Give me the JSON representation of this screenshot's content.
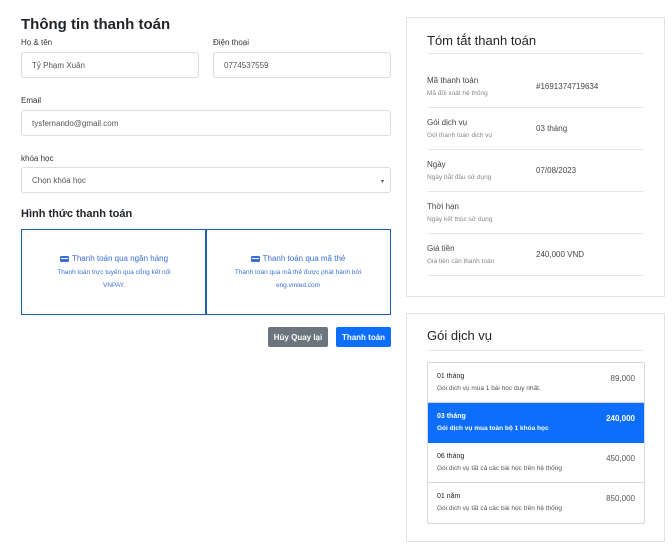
{
  "form": {
    "title": "Thông tin thanh toán",
    "name_label": "Họ & tên",
    "name_value": "Tỷ Phạm Xuân",
    "phone_label": "Điện thoại",
    "phone_value": "0774537559",
    "email_label": "Email",
    "email_value": "tysfernando@gmail.com",
    "course_label": "khóa học",
    "course_value": "Chọn khóa học",
    "payment_title": "Hình thức thanh toán",
    "payment_methods": [
      {
        "title": "Thanh toán qua ngân hàng",
        "desc_line1": "Thanh toán trực tuyến qua cổng kết nối",
        "desc_line2": "VNPAY.",
        "icon": "bank-card-icon"
      },
      {
        "title": "Thanh toán qua mã thẻ",
        "desc_line1": "Thanh toán qua mã thẻ được phát hành bởi",
        "desc_line2": "eng.vmied.com",
        "icon": "credit-card-icon"
      }
    ],
    "cancel_label": "Hủy Quay lại",
    "submit_label": "Thanh toán"
  },
  "summary": {
    "title": "Tóm tắt thanh toán",
    "rows": [
      {
        "key": "Mã thanh toán",
        "sub": "Mã đối xoát hệ thống",
        "value": "#1691374719634"
      },
      {
        "key": "Gói dịch vụ",
        "sub": "Gói thanh toán dịch vụ",
        "value": "03 tháng"
      },
      {
        "key": "Ngày",
        "sub": "Ngày bắt đầu sử dụng",
        "value": "07/08/2023"
      },
      {
        "key": "Thời hạn",
        "sub": "Ngày kết thúc sử dụng",
        "value": ""
      },
      {
        "key": "Giá tiền",
        "sub": "Giá tiền cần thanh toán",
        "value": "240,000 VND"
      }
    ]
  },
  "plans": {
    "title": "Gói dịch vụ",
    "items": [
      {
        "name": "01 tháng",
        "desc": "Gói dịch vụ mua 1 bài học duy nhất.",
        "price": "89,000",
        "active": false
      },
      {
        "name": "03 tháng",
        "desc": "Gói dịch vụ mua toàn bộ 1 khóa học",
        "price": "240,000",
        "active": true
      },
      {
        "name": "06 tháng",
        "desc": "Gói dịch vụ tất cả các bài học trên hệ thống",
        "price": "450,000",
        "active": false
      },
      {
        "name": "01 năm",
        "desc": "Gói dịch vụ tất cả các bài học trên hệ thống",
        "price": "850,000",
        "active": false
      }
    ]
  },
  "colors": {
    "primary": "#0d6efd",
    "secondary": "#6c757d",
    "payment_border": "#1f5fa8",
    "payment_text": "#3a6fd8"
  }
}
